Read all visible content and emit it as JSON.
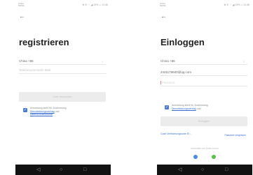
{
  "register": {
    "status_carrier": "China Mobile",
    "status_right": "⊕ ✆ ⌔ ◢ 13% ▭ 11:46",
    "title": "registrieren",
    "country": "China +86",
    "account_placeholder": "Telefonnummer/E-Mail",
    "continue_label": "Code bekommen",
    "agree_text": "Anmeldung steht für Zustimmung",
    "agree_link1": "Dienstleistungsvertrag",
    "agree_and": "und",
    "agree_link2": "Datenschutzrichtlinie"
  },
  "login": {
    "status_carrier": "China Mobile",
    "status_right": "⊕ ✆ ⌔ ◢ 13% ▭ 11:46",
    "title": "Einloggen",
    "country": "China +86",
    "account": "2421179600@qq.com",
    "password_placeholder": "Passwort",
    "agree_text": "Anmeldung steht für Zustimmung",
    "agree_link1": "Dienstleistungsvertrag",
    "agree_and": "und",
    "login_label": "Einloggen",
    "code_login": "Code-Verifizierungscode Ei...",
    "forgot_password": "Passwort vergessen",
    "other_login": "Anmelden mit Dritte-Konto",
    "social_colors": [
      "#4a8be0",
      "#5cbf4a"
    ]
  },
  "navbar": {
    "back": "◁",
    "home": "○",
    "recent": "□"
  }
}
